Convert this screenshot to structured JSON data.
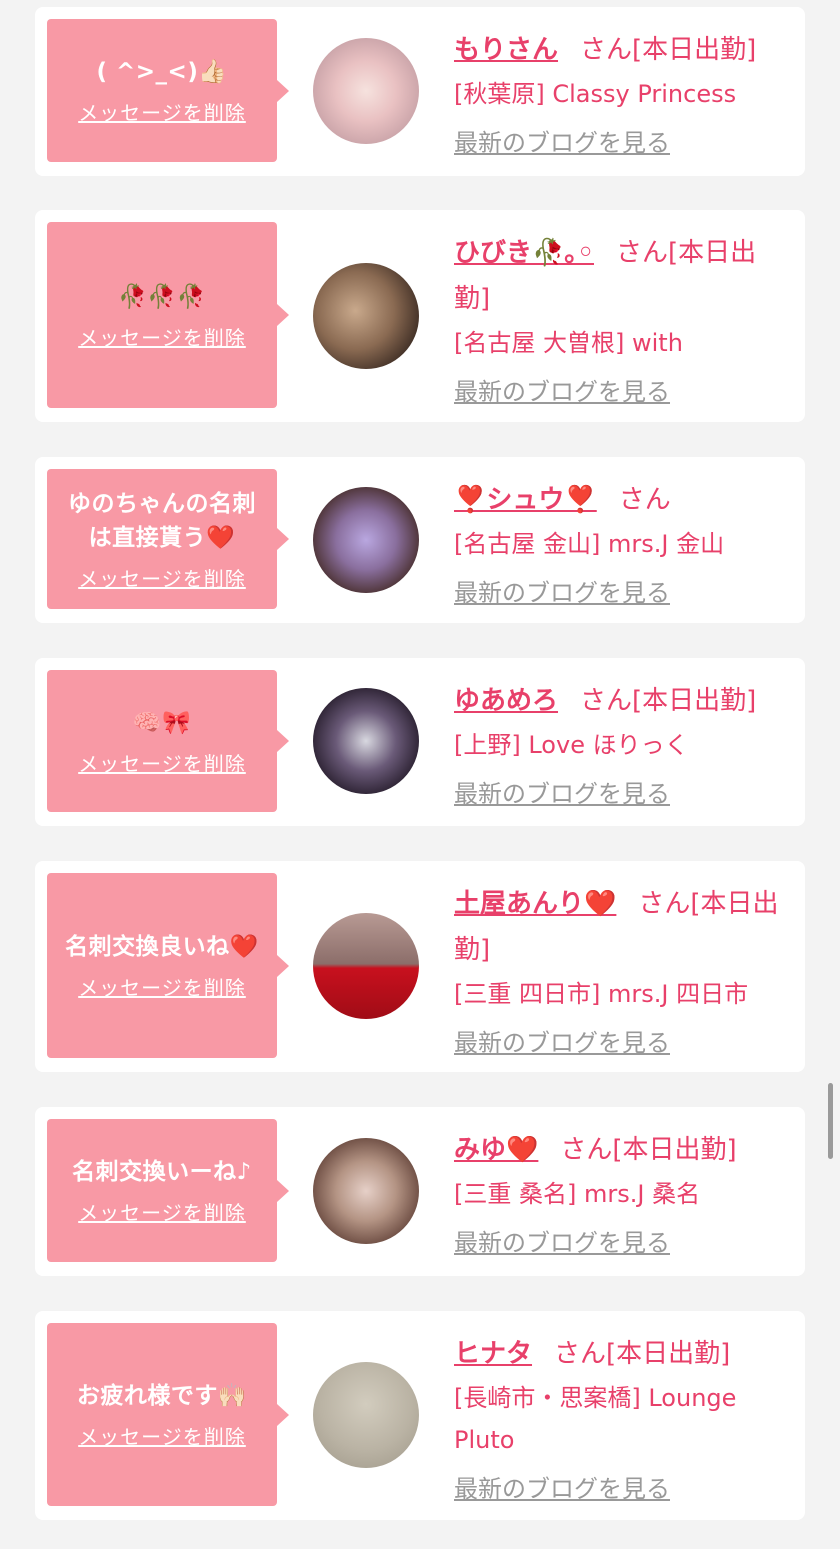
{
  "common": {
    "delete_label": "メッセージを削除",
    "blog_label": "最新のブログを見る"
  },
  "colors": {
    "accent": "#e8406a",
    "bubble": "#f899a5",
    "link_gray": "#999999"
  },
  "items": [
    {
      "message": "( ^>_<)👍🏻",
      "name": "もりさん",
      "honorific": "さん[本日出勤]",
      "shop": "[秋葉原] Classy Princess",
      "avatar": "pink-hair-anime-avatar"
    },
    {
      "message": "🥀🥀🥀",
      "name": "ひびき🥀｡◦",
      "honorific": "さん[本日出勤]",
      "shop": "[名古屋 大曽根] with",
      "avatar": "masked-woman-photo"
    },
    {
      "message": "ゆのちゃんの名刺は直接貰う❤️",
      "name": "❣️シュウ❣️",
      "honorific": "さん",
      "shop": "[名古屋 金山] mrs.J 金山",
      "avatar": "woman-hand-over-face-photo"
    },
    {
      "message": "🧠🎀",
      "name": "ゆあめろ",
      "honorific": "さん[本日出勤]",
      "shop": "[上野] Love ほりっく",
      "avatar": "dark-hair-woman-photo"
    },
    {
      "message": "名刺交換良いね❤️",
      "name": "土屋あんり❤️",
      "honorific": "さん[本日出勤]",
      "shop": "[三重 四日市] mrs.J 四日市",
      "avatar": "woman-red-card-photo"
    },
    {
      "message": "名刺交換いーね♪",
      "name": "みゆ❤️",
      "honorific": "さん[本日出勤]",
      "shop": "[三重 桑名] mrs.J 桑名",
      "avatar": "woman-fur-hood-photo"
    },
    {
      "message": "お疲れ様です🙌🏻",
      "name": "ヒナタ",
      "honorific": "さん[本日出勤]",
      "shop": "[長崎市・思案橋] Lounge Pluto",
      "avatar": "blurry-gray-photo"
    }
  ]
}
